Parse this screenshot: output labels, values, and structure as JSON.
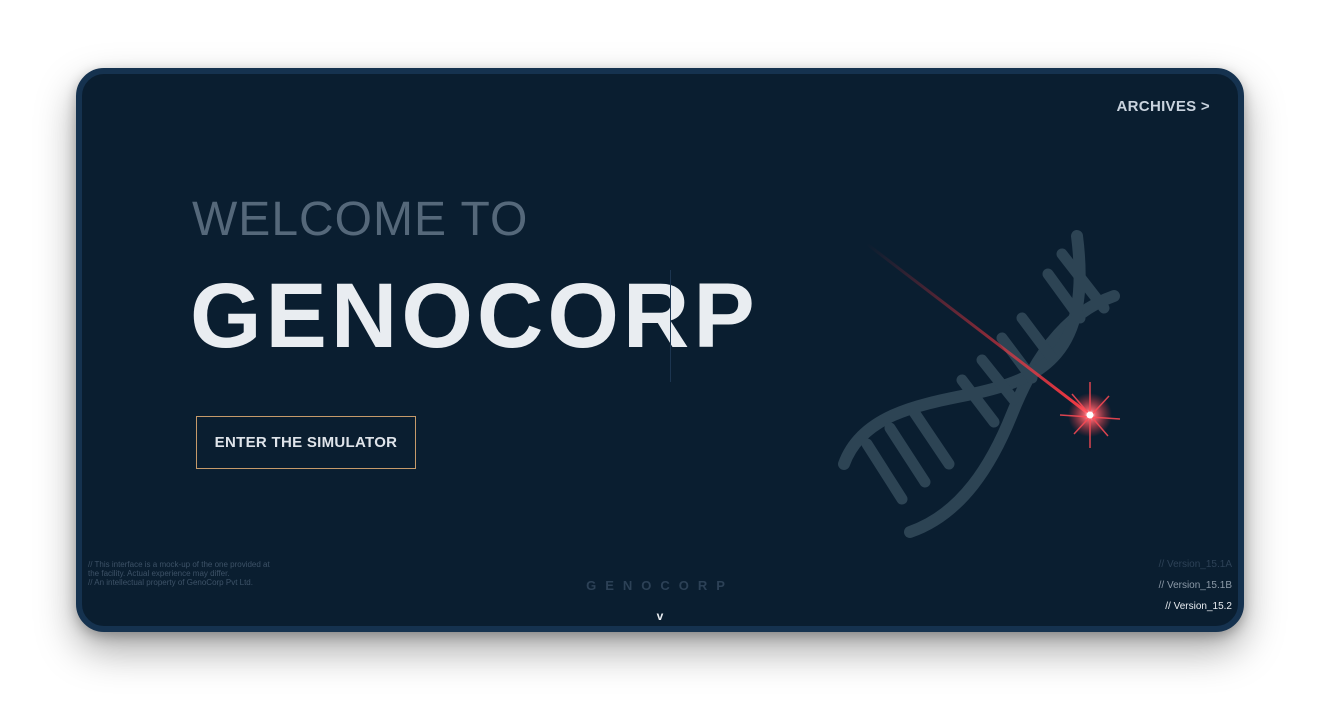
{
  "nav": {
    "archives_label": "ARCHIVES >"
  },
  "hero": {
    "welcome": "WELCOME TO",
    "brand": "GENOCORP",
    "cta_label": "ENTER THE SIMULATOR"
  },
  "footer": {
    "disclaimer_lines": [
      "// This interface is a mock-up of the one provided at the facility. Actual experience may differ.",
      "// An intellectual property of GenoCorp Pvt Ltd."
    ],
    "brand": "GENOCORP",
    "scroll_indicator": "v",
    "versions": [
      "// Version_15.1A",
      "// Version_15.1B",
      "// Version_15.2"
    ]
  },
  "colors": {
    "background": "#0a1e30",
    "frame_border": "#15324f",
    "cta_border": "#c59a6a",
    "dna_strand": "#2d4454",
    "laser": "#e0303a"
  },
  "icons": {
    "hero_graphic": "dna-helix-laser-icon"
  }
}
